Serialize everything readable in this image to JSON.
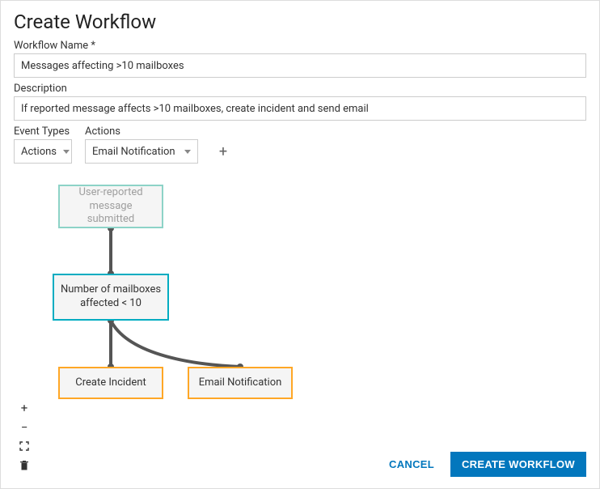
{
  "title": "Create Workflow",
  "fields": {
    "name_label": "Workflow Name *",
    "name_value": "Messages affecting >10 mailboxes",
    "desc_label": "Description",
    "desc_value": "If reported message affects >10 mailboxes, create incident and send email"
  },
  "selectors": {
    "event_types_label": "Event Types",
    "event_types_value": "Actions",
    "actions_label": "Actions",
    "actions_value": "Email Notification"
  },
  "flow": {
    "start": "User-reported message submitted",
    "condition": "Number of mailboxes affected < 10",
    "action1": "Create Incident",
    "action2": "Email Notification"
  },
  "footer": {
    "cancel": "CANCEL",
    "create": "CREATE WORKFLOW"
  }
}
